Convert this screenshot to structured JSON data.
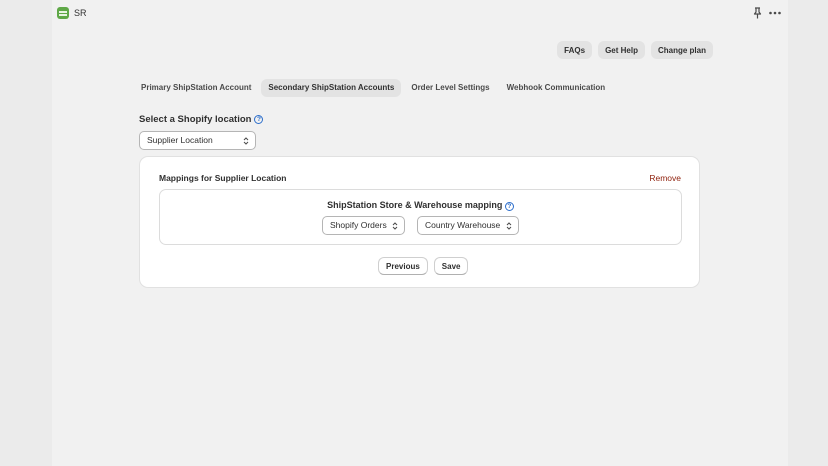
{
  "app": {
    "name": "SR"
  },
  "header": {
    "pin_icon": "pin-icon",
    "more_icon": "more-horizontal-icon",
    "actions": [
      "FAQs",
      "Get Help",
      "Change plan"
    ]
  },
  "tabs": [
    {
      "label": "Primary ShipStation Account",
      "active": false
    },
    {
      "label": "Secondary ShipStation Accounts",
      "active": true
    },
    {
      "label": "Order Level Settings",
      "active": false
    },
    {
      "label": "Webhook Communication",
      "active": false
    }
  ],
  "location": {
    "heading": "Select a Shopify location",
    "selected": "Supplier Location"
  },
  "mapping_card": {
    "title": "Mappings for Supplier Location",
    "remove_label": "Remove",
    "section_title": "ShipStation Store & Warehouse mapping",
    "store_select": "Shopify Orders",
    "warehouse_select": "Country Warehouse",
    "previous_label": "Previous",
    "save_label": "Save"
  },
  "colors": {
    "accent": "#2c6ecb",
    "destructive": "#8e1f0b",
    "logo": "#5fa847"
  }
}
